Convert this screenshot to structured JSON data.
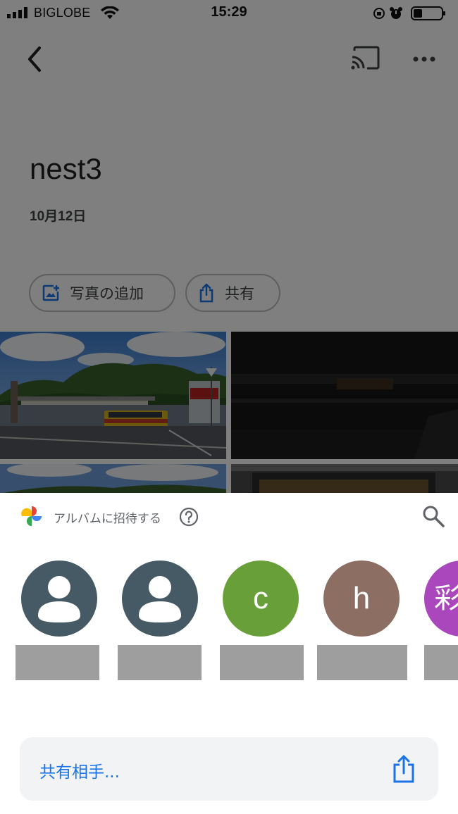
{
  "status_bar": {
    "carrier": "BIGLOBE",
    "time": "15:29"
  },
  "album": {
    "title": "nest3",
    "date": "10月12日",
    "add_photos_label": "写真の追加",
    "share_label": "共有"
  },
  "sheet": {
    "invite_label": "アルバムに招待する",
    "contacts": [
      {
        "type": "avatar",
        "letter": "",
        "color": "#455a64"
      },
      {
        "type": "avatar",
        "letter": "",
        "color": "#455a64"
      },
      {
        "type": "letter",
        "letter": "c",
        "color": "#689f38"
      },
      {
        "type": "letter",
        "letter": "h",
        "color": "#8d6e63"
      },
      {
        "type": "letter",
        "letter": "彩",
        "color": "#ab47bc"
      }
    ],
    "share_with_label": "共有相手..."
  },
  "colors": {
    "accent": "#1a73e8",
    "dim_overlay": "rgba(0,0,0,0.5)"
  },
  "icons": {
    "back": "chevron-left-icon",
    "cast": "cast-icon",
    "more": "more-horiz-icon",
    "add_photo": "add-photo-icon",
    "share": "share-icon",
    "help": "help-icon",
    "search": "search-icon",
    "logo": "google-photos-logo"
  }
}
